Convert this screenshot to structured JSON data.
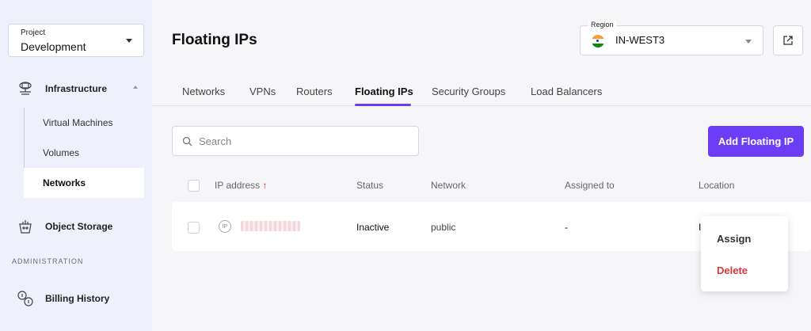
{
  "sidebar": {
    "project": {
      "label": "Project",
      "value": "Development"
    },
    "infrastructure": {
      "label": "Infrastructure",
      "items": [
        {
          "label": "Virtual Machines"
        },
        {
          "label": "Volumes"
        },
        {
          "label": "Networks",
          "active": true
        }
      ]
    },
    "object_storage": {
      "label": "Object Storage"
    },
    "section_admin": "ADMINISTRATION",
    "billing": {
      "label": "Billing History"
    }
  },
  "main": {
    "title": "Floating IPs",
    "region": {
      "label": "Region",
      "value": "IN-WEST3",
      "flag": "india-flag-icon"
    },
    "tabs": [
      {
        "label": "Networks"
      },
      {
        "label": "VPNs"
      },
      {
        "label": "Routers"
      },
      {
        "label": "Floating IPs",
        "active": true
      },
      {
        "label": "Security Groups"
      },
      {
        "label": "Load Balancers"
      }
    ],
    "search": {
      "placeholder": "Search",
      "value": ""
    },
    "add_button": "Add Floating IP",
    "table": {
      "columns": [
        "IP address",
        "Status",
        "Network",
        "Assigned to",
        "Location"
      ],
      "sort_indicator": "↑",
      "rows": [
        {
          "ip_badge": "IP",
          "status": "Inactive",
          "network": "public",
          "assigned_to": "-",
          "location": "I"
        }
      ]
    },
    "context_menu": {
      "assign": "Assign",
      "delete": "Delete"
    }
  },
  "colors": {
    "accent": "#6b3df5",
    "danger": "#d9363e",
    "sort_arrow": "#e0303a"
  }
}
